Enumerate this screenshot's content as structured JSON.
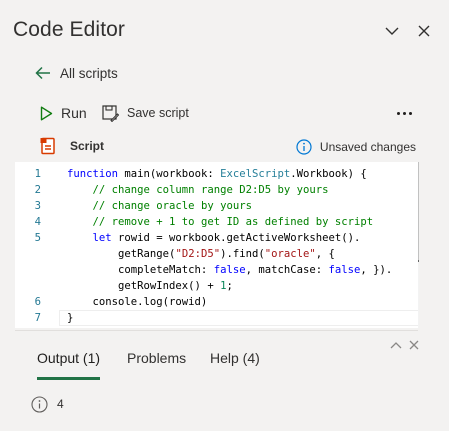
{
  "pane": {
    "title": "Code Editor",
    "collapse_icon": "chevron-down-icon",
    "close_icon": "close-icon"
  },
  "nav": {
    "back_label": "All scripts",
    "back_icon": "arrow-left-icon"
  },
  "toolbar": {
    "run_label": "Run",
    "save_label": "Save script",
    "more_icon": "more-horizontal-icon"
  },
  "script": {
    "label": "Script",
    "status": "Unsaved changes",
    "status_icon": "info-icon"
  },
  "editor": {
    "line_numbers": [
      "1",
      "2",
      "3",
      "4",
      "5",
      "",
      "",
      "",
      "6",
      "7"
    ],
    "lines": [
      "function main(workbook: ExcelScript.Workbook) {",
      "    // change column range D2:D5 by yours",
      "    // change oracle by yours",
      "    // remove + 1 to get ID as defined by script",
      "    let rowid = workbook.getActiveWorksheet().",
      "        getRange(\"D2:D5\").find(\"oracle\", {",
      "        completeMatch: false, matchCase: false, }).",
      "        getRowIndex() + 1;",
      "    console.log(rowid)",
      "}"
    ]
  },
  "output_panel": {
    "tabs": [
      {
        "label": "Output (1)",
        "active": true
      },
      {
        "label": "Problems",
        "active": false
      },
      {
        "label": "Help (4)",
        "active": false
      }
    ],
    "output_value": "4",
    "output_icon": "info-icon"
  },
  "colors": {
    "accent": "#217346",
    "run_green": "#107c10",
    "info_blue": "#0078d4",
    "script_icon_red": "#d83b01",
    "keyword": "#0000ff",
    "comment": "#008000",
    "string": "#a31515",
    "number": "#098658",
    "type": "#267f99",
    "line_number": "#237893"
  }
}
